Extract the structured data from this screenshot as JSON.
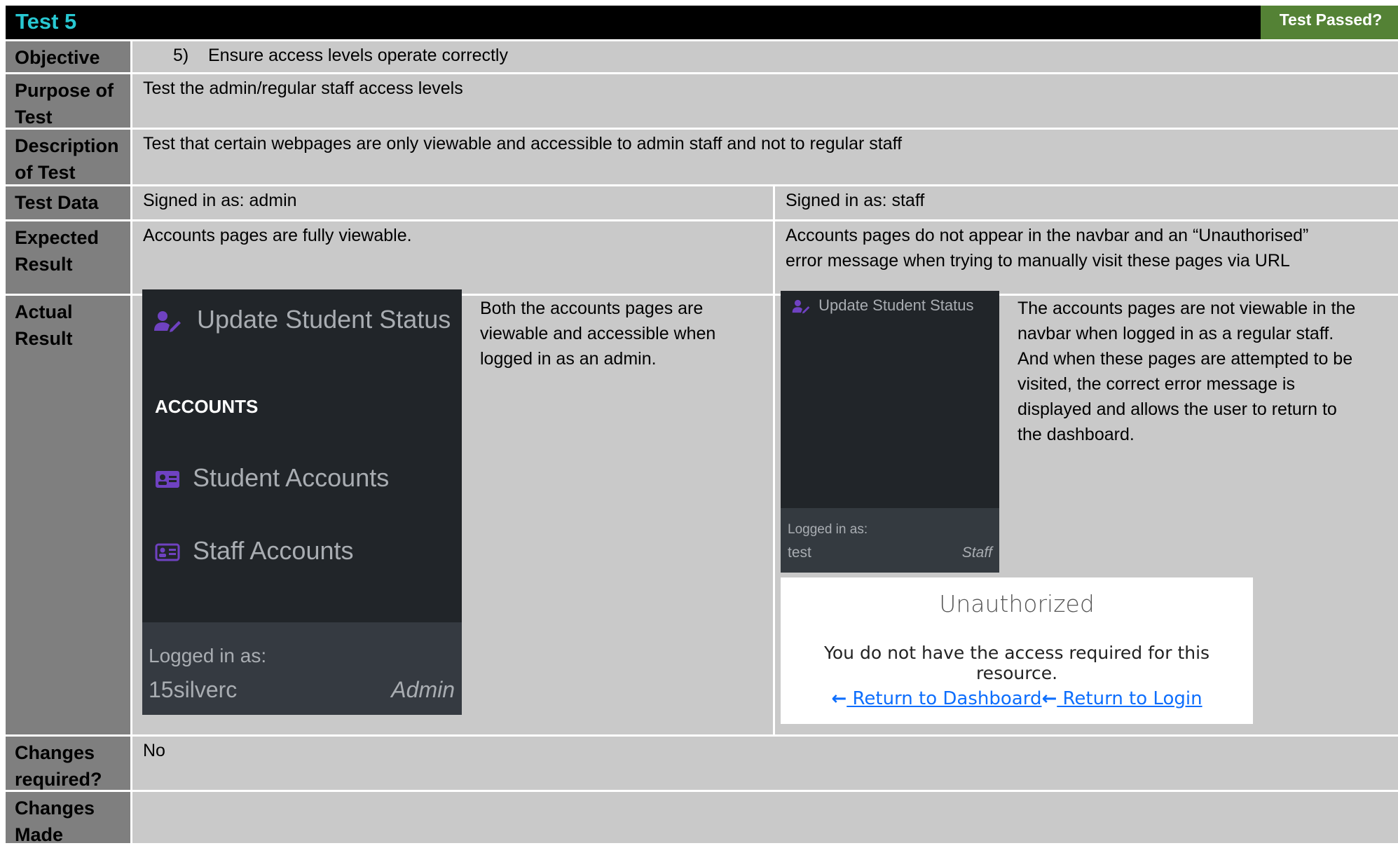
{
  "header": {
    "title": "Test 5",
    "passed_label": "Test Passed?"
  },
  "rows": {
    "objective": {
      "label": "Objective",
      "num": "5)",
      "value": "Ensure access levels operate correctly"
    },
    "purpose": {
      "label_1": "Purpose of",
      "label_2": "Test",
      "value": "Test the admin/regular staff access levels"
    },
    "description": {
      "label_1": "Description",
      "label_2": "of Test",
      "value": "Test that certain webpages are only viewable and accessible to admin staff and not to regular staff"
    },
    "test_data": {
      "label": "Test Data",
      "left": "Signed in as: admin",
      "right": "Signed in as: staff"
    },
    "expected": {
      "label_1": "Expected",
      "label_2": "Result",
      "left": "Accounts pages are fully viewable.",
      "right_1": "Accounts pages do not appear in the navbar and an “Unauthorised”",
      "right_2": "error message when trying to manually visit these pages via URL"
    },
    "actual": {
      "label_1": "Actual",
      "label_2": "Result",
      "left_text": [
        "Both the accounts pages are",
        "viewable and accessible when",
        "logged in as an admin."
      ],
      "right_text": [
        "The accounts pages are not viewable in the",
        "navbar when logged in as a regular staff.",
        "And when these pages are attempted to be",
        "visited, the correct error message is",
        "displayed and allows the user to return to",
        "the dashboard."
      ]
    },
    "changes_required": {
      "label_1": "Changes",
      "label_2": "required?",
      "value": "No"
    },
    "changes_made": {
      "label_1": "Changes",
      "label_2": "Made",
      "value": ""
    }
  },
  "admin_shot": {
    "update_status": "Update Student Status",
    "section": "ACCOUNTS",
    "student_accounts": "Student Accounts",
    "staff_accounts": "Staff Accounts",
    "logged_in_label": "Logged in as:",
    "username": "15silverc",
    "role": "Admin"
  },
  "staff_shot": {
    "update_status": "Update Student Status",
    "logged_in_label": "Logged in as:",
    "username": "test",
    "role": "Staff"
  },
  "unauthorized": {
    "title": "Unauthorized",
    "message": "You do not have the access required for this resource.",
    "dashboard_link": " Return to Dashboard",
    "login_link": " Return to Login"
  },
  "colors": {
    "header_bg": "#000000",
    "title": "#28c8d2",
    "passed_bg": "#548235",
    "label_bg": "#7f7f7f",
    "cell_bg": "#c9c9c9",
    "link": "#0d6efd",
    "icon_purple": "#6f42c1"
  }
}
